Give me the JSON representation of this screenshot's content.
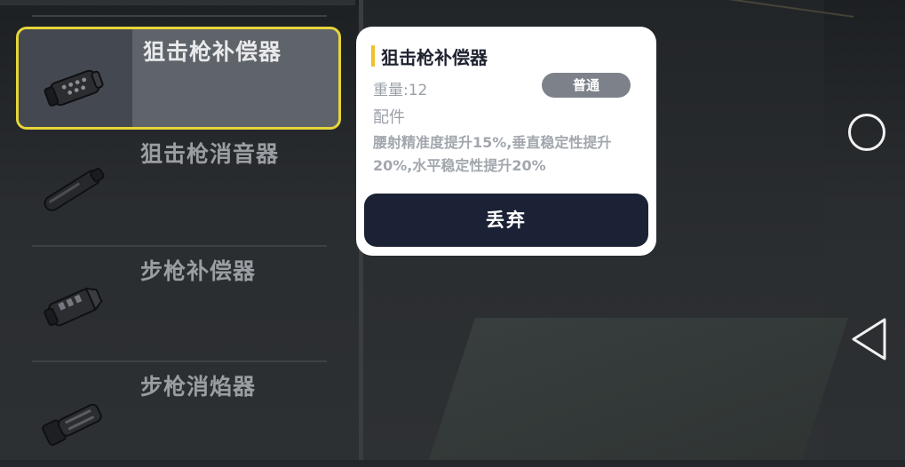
{
  "inventory": {
    "items": [
      {
        "name": "狙击枪补偿器",
        "icon": "sniper-compensator-icon",
        "selected": true
      },
      {
        "name": "狙击枪消音器",
        "icon": "sniper-suppressor-icon",
        "selected": false
      },
      {
        "name": "步枪补偿器",
        "icon": "rifle-compensator-icon",
        "selected": false
      },
      {
        "name": "步枪消焰器",
        "icon": "rifle-flash-hider-icon",
        "selected": false
      }
    ]
  },
  "detail": {
    "title": "狙击枪补偿器",
    "weight": "重量:12",
    "rarity": "普通",
    "category": "配件",
    "description": "腰射精准度提升15%,垂直稳定性提升20%,水平稳定性提升20%",
    "discard_label": "丢弃"
  },
  "navigation": {
    "home_icon": "circle-home-icon",
    "back_icon": "triangle-back-icon"
  },
  "colors": {
    "selection_border": "#e6d53a",
    "title_accent": "#f1bf2b",
    "discard_button": "#1c2235"
  }
}
